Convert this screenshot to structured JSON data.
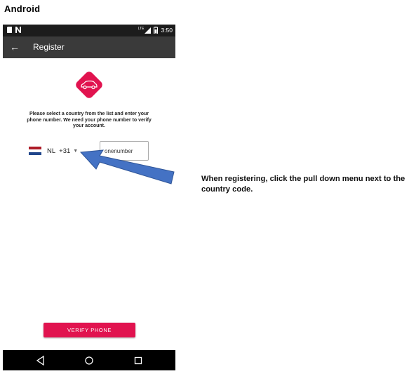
{
  "platform_label": "Android",
  "status_bar": {
    "network": "LTE",
    "time": "3:50"
  },
  "app_bar": {
    "back_icon": "arrow-left",
    "title": "Register"
  },
  "logo": {
    "icon": "car-icon",
    "color": "#e1134f"
  },
  "instructions": "Please select a country from the list and enter your phone number. We need your phone number to verify your account.",
  "country_picker": {
    "country": "NL",
    "dial_code": "+31",
    "flag_colors": [
      "#ae1c28",
      "#ffffff",
      "#21468b"
    ],
    "chevron": "▼"
  },
  "phone_input": {
    "placeholder": "onenumber",
    "value": ""
  },
  "verify_button": {
    "label": "VERIFY PHONE",
    "color": "#e1134f"
  },
  "nav_bar": [
    "back-triangle-icon",
    "home-circle-icon",
    "recents-square-icon"
  ],
  "annotation": {
    "text": "When registering, click the pull down menu next to the country code.",
    "arrow_color": "#4472c4"
  }
}
